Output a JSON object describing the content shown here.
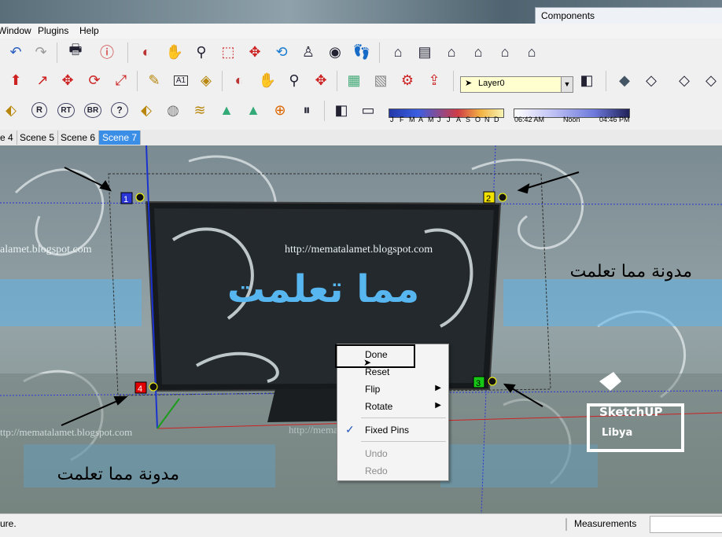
{
  "components_panel": {
    "title": "Components"
  },
  "menu": {
    "items": [
      "Window",
      "Plugins",
      "Help"
    ]
  },
  "toolbar": {
    "layer": "Layer0",
    "months": [
      "J",
      "F",
      "M",
      "A",
      "M",
      "J",
      "J",
      "A",
      "S",
      "O",
      "N",
      "D"
    ],
    "time_labels": [
      "06:42 AM",
      "Noon",
      "04:46 PM"
    ],
    "text_tool_label": "A1",
    "plugin_labels": [
      "R",
      "RT",
      "BR",
      "?"
    ]
  },
  "scenes": {
    "tabs": [
      "e 4",
      "Scene 5",
      "Scene 6",
      "Scene 7"
    ],
    "active": "Scene 7"
  },
  "viewport": {
    "url_center": "http://mematalamet.blogspot.com",
    "url_left": "alamet.blogspot.com",
    "url_left_bottom": "ttp://mematalamet.blogspot.com",
    "url_bottom_center": "http://mematalamet.blogspot.com",
    "arabic_center": "مما تعلمت",
    "arabic_right": "مدونة مما تعلمت",
    "arabic_left_bottom": "مدونة مما تعلمت",
    "pin_numbers": [
      "1",
      "2",
      "3",
      "4"
    ]
  },
  "logo": {
    "line1": "SketchUP",
    "line2": "Libya"
  },
  "context_menu": {
    "items": [
      {
        "label": "Done",
        "enabled": true
      },
      {
        "label": "Reset",
        "enabled": true
      },
      {
        "label": "Flip",
        "enabled": true,
        "submenu": true
      },
      {
        "label": "Rotate",
        "enabled": true,
        "submenu": true
      },
      {
        "label": "Fixed Pins",
        "enabled": true,
        "checked": true
      },
      {
        "label": "Undo",
        "enabled": false
      },
      {
        "label": "Redo",
        "enabled": false
      }
    ]
  },
  "status": {
    "text": "ure.",
    "measurements_label": "Measurements"
  },
  "colors": {
    "accent": "#3a8ee6",
    "pin1": "#2a35d8",
    "pin2": "#f2e200",
    "pin3": "#16c716",
    "pin4": "#e00000"
  }
}
